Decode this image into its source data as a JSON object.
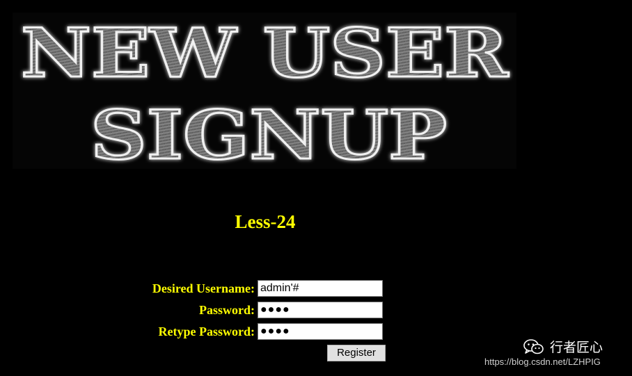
{
  "banner": {
    "line1": "NEW USER",
    "line2": "SIGNUP"
  },
  "heading": "Less-24",
  "form": {
    "username": {
      "label": "Desired Username:",
      "value": "admin'#"
    },
    "password": {
      "label": "Password:",
      "masked_value": "●●●●"
    },
    "retype_password": {
      "label": "Retype Password:",
      "masked_value": "●●●●"
    },
    "register_label": "Register"
  },
  "watermark": {
    "brand": "行者匠心",
    "url": "https://blog.csdn.net/LZHPIG"
  },
  "colors": {
    "background": "#000000",
    "label_text": "#ffff00"
  },
  "icons": {
    "brand": "wechat-icon"
  }
}
